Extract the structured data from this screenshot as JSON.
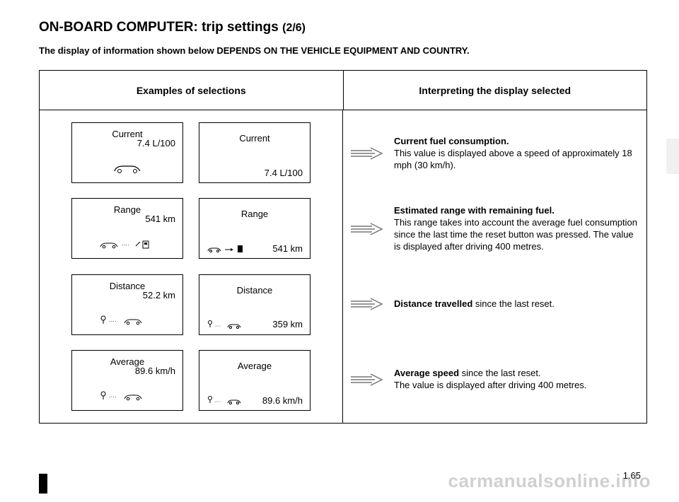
{
  "title_main": "ON-BOARD COMPUTER: trip settings ",
  "title_sub": "(2/6)",
  "notice": "The display of information shown below DEPENDS ON THE VEHICLE EQUIPMENT AND COUNTRY.",
  "header_left": "Examples of selections",
  "header_right": "Interpreting the display selected",
  "rows": [
    {
      "a_label": "Current",
      "a_value": "7.4 L/100",
      "b_label": "Current",
      "b_value": "7.4 L/100",
      "desc_bold": "Current fuel consumption.",
      "desc_rest": "This value is displayed above a speed of approximately 18 mph (30 km/h)."
    },
    {
      "a_label": "Range",
      "a_value": "541 km",
      "b_label": "Range",
      "b_value": "541 km",
      "desc_bold": "Estimated range with remaining fuel.",
      "desc_rest": "This range takes into account the average fuel consumption since the last time the reset button was pressed. The value is displayed after driving 400 metres."
    },
    {
      "a_label": "Distance",
      "a_value": "52.2 km",
      "b_label": "Distance",
      "b_value": "359 km",
      "desc_bold": "Distance travelled ",
      "desc_rest": "since the last reset."
    },
    {
      "a_label": "Average",
      "a_value": "89.6 km/h",
      "b_label": "Average",
      "b_value": "89.6 km/h",
      "desc_bold": "Average speed ",
      "desc_rest": "since the last reset.",
      "desc_line2": "The value is displayed after driving 400 metres."
    }
  ],
  "page_num": "1.65",
  "watermark": "carmanualsonline.info"
}
